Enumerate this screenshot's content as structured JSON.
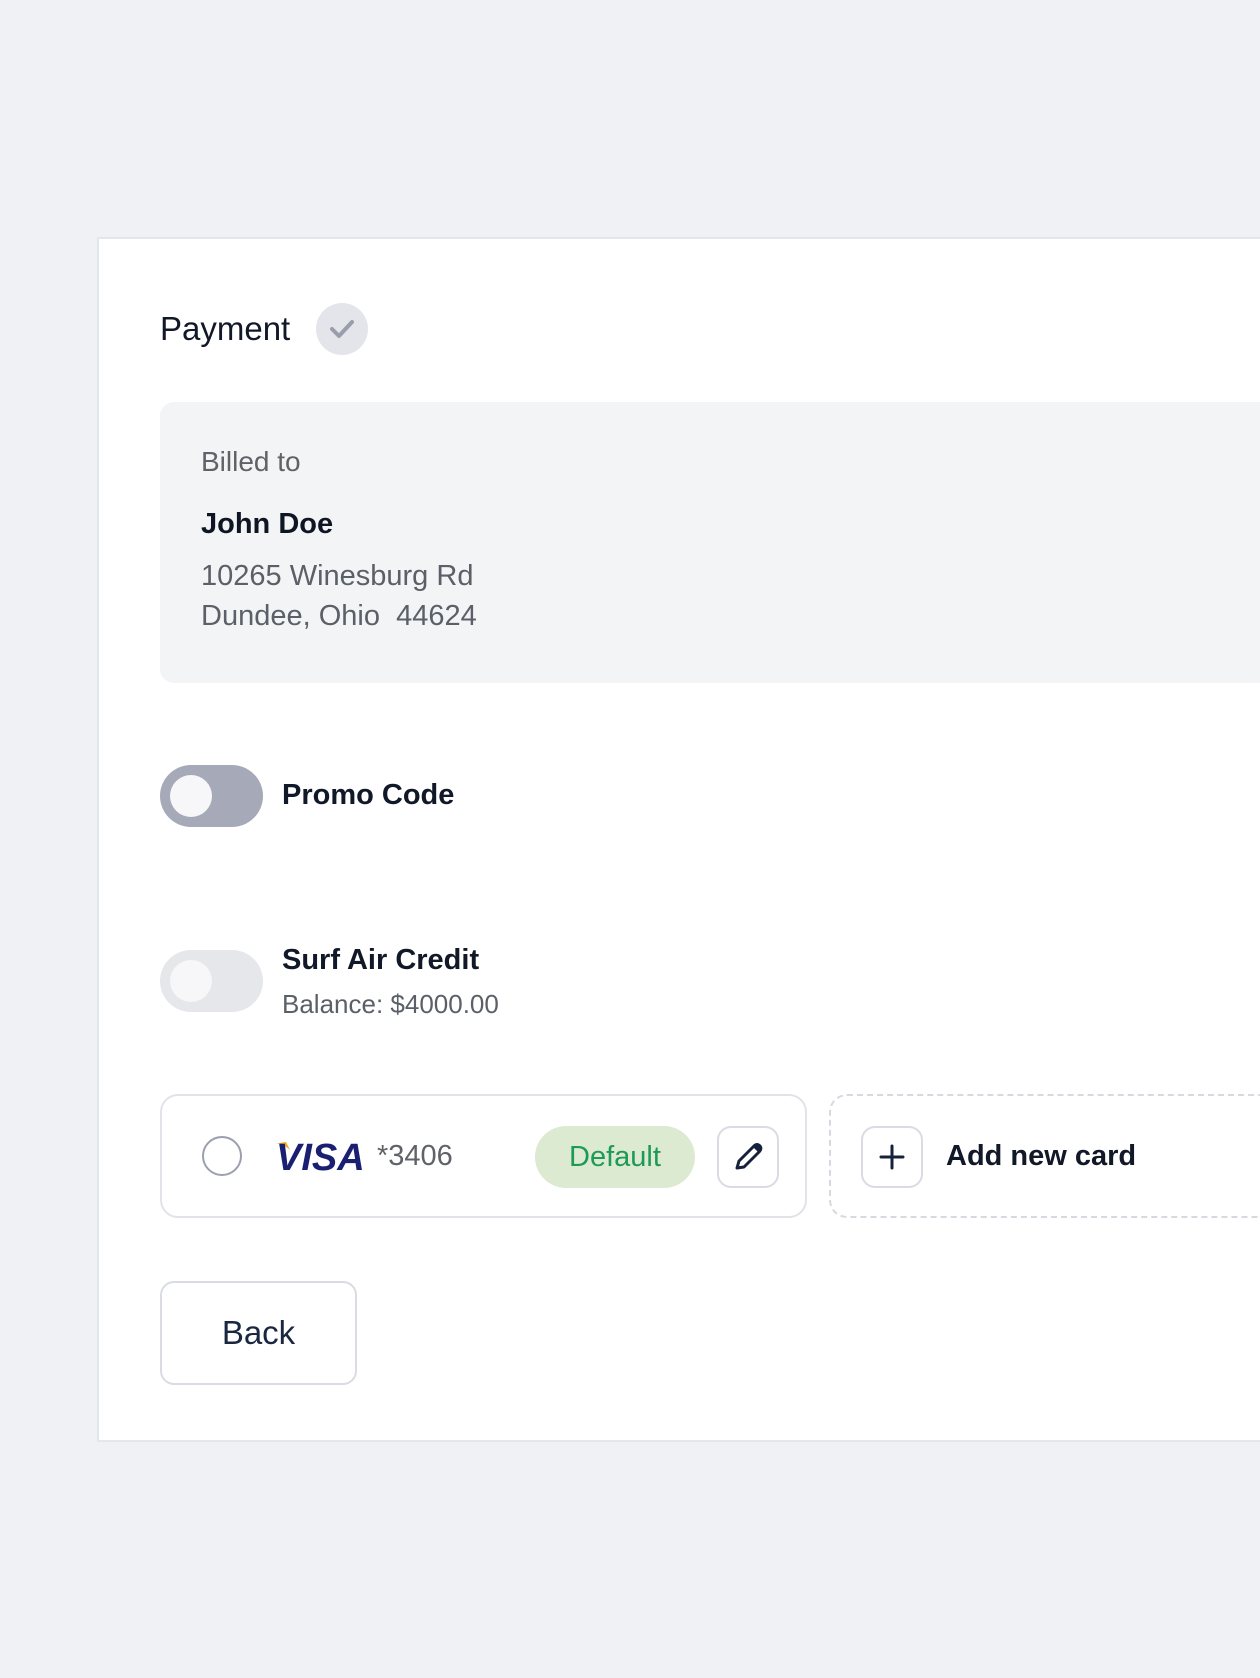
{
  "payment": {
    "title": "Payment",
    "status_icon": "check-icon"
  },
  "billing": {
    "label": "Billed to",
    "name": "John Doe",
    "address_line1": "10265 Winesburg Rd",
    "address_line2": "Dundee, Ohio  44624"
  },
  "promo": {
    "label": "Promo Code",
    "enabled": false
  },
  "credit": {
    "label": "Surf Air Credit",
    "balance": "Balance: $4000.00",
    "enabled": false
  },
  "saved_card": {
    "brand": "VISA",
    "number": "*3406",
    "badge": "Default",
    "selected": false,
    "edit_icon": "pencil-icon"
  },
  "add_card": {
    "label": "Add new card",
    "icon": "plus-icon"
  },
  "actions": {
    "back_label": "Back"
  },
  "colors": {
    "background": "#eff1f5",
    "badge_bg": "#dcead1",
    "badge_text": "#1f9a55",
    "visa_blue": "#1a1f71",
    "visa_gold": "#f7a71c"
  }
}
